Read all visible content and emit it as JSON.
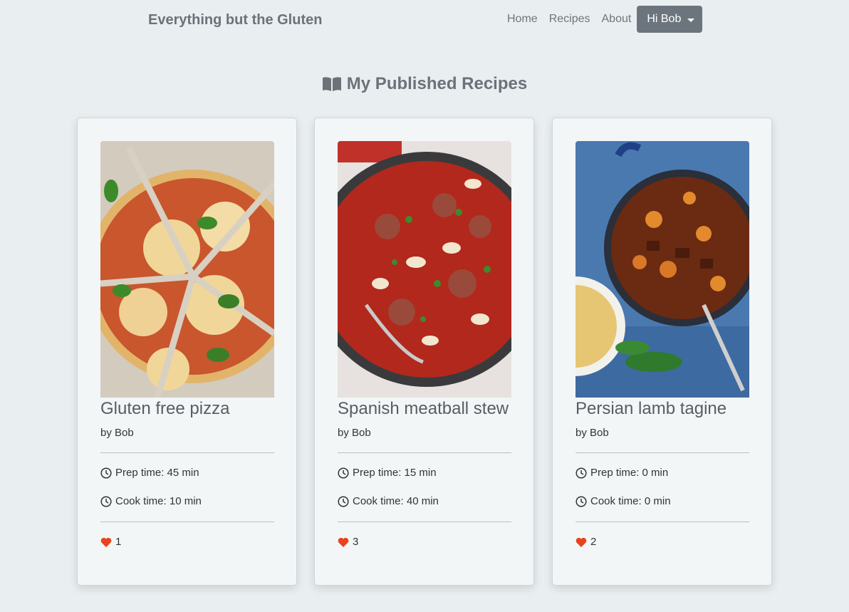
{
  "nav": {
    "brand": "Everything but the Gluten",
    "links": [
      "Home",
      "Recipes",
      "About"
    ],
    "user_menu": "Hi Bob"
  },
  "page": {
    "title": "My Published Recipes",
    "title_icon": "book-open-icon"
  },
  "recipes": [
    {
      "title": "Gluten free pizza",
      "author": "by Bob",
      "prep": "Prep time: 45 min",
      "cook": "Cook time: 10 min",
      "likes": "1",
      "image": "pizza-photo"
    },
    {
      "title": "Spanish meatball stew",
      "author": "by Bob",
      "prep": "Prep time: 15 min",
      "cook": "Cook time: 40 min",
      "likes": "3",
      "image": "meatball-stew-photo"
    },
    {
      "title": "Persian lamb tagine",
      "author": "by Bob",
      "prep": "Prep time: 0 min",
      "cook": "Cook time: 0 min",
      "likes": "2",
      "image": "lamb-tagine-photo"
    }
  ],
  "colors": {
    "background": "#e9eef0",
    "card": "#f3f6f7",
    "accent_button": "#6c757d",
    "heart": "#e8421f"
  }
}
